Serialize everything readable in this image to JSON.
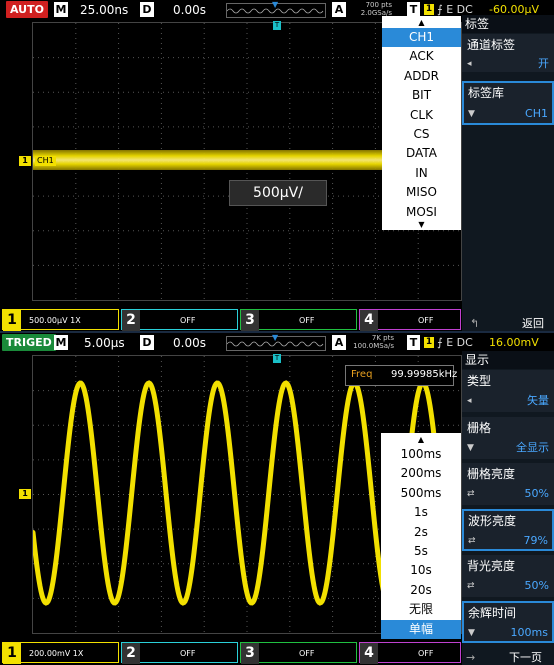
{
  "top": {
    "status": "AUTO",
    "m_label": "M",
    "timebase": "25.00ns",
    "d_label": "D",
    "delay": "0.00s",
    "pts_line1": "700 pts",
    "pts_line2": "2.0GSa/s",
    "trig_t": "T",
    "trig_ch": "1",
    "trig_edge": "⨍ E DC",
    "trig_level": "-60.00μV",
    "a_label": "A",
    "ch1_marker": "1",
    "ch1_tag": "CH1",
    "scale_box": "500μV/",
    "t_marker": "T",
    "menu": {
      "title": "标签",
      "item1_label": "通道标签",
      "item1_value": "开",
      "item2_label": "标签库",
      "item2_value": "CH1",
      "back": "返回"
    },
    "dropdown": [
      "CH1",
      "ACK",
      "ADDR",
      "BIT",
      "CLK",
      "CS",
      "DATA",
      "IN",
      "MISO",
      "MOSI"
    ],
    "dropdown_selected": "CH1",
    "channels": [
      {
        "num": "1",
        "text": "500.00μV  1X"
      },
      {
        "num": "2",
        "text": "OFF"
      },
      {
        "num": "3",
        "text": "OFF"
      },
      {
        "num": "4",
        "text": "OFF"
      }
    ],
    "colors": {
      "ch1": "#f2e000",
      "ch2": "#2ad0d8",
      "ch3": "#20c040",
      "ch4": "#c040d0",
      "accent": "#2a8ad8"
    }
  },
  "bottom": {
    "status": "TRIGED",
    "m_label": "M",
    "timebase": "5.00μs",
    "d_label": "D",
    "delay": "0.00s",
    "pts_line1": "7K pts",
    "pts_line2": "100.0MSa/s",
    "a_label": "A",
    "trig_t": "T",
    "trig_ch": "1",
    "trig_edge": "⨍ E DC",
    "trig_level": "16.00mV",
    "ch1_marker": "1",
    "t_marker": "T",
    "freq_label": "Freq",
    "freq_value": "99.99985kHz",
    "menu": {
      "title": "显示",
      "items": [
        {
          "label": "类型",
          "value": "矢量"
        },
        {
          "label": "栅格",
          "value": "全显示"
        },
        {
          "label": "栅格亮度",
          "value": "50%"
        },
        {
          "label": "波形亮度",
          "value": "79%"
        },
        {
          "label": "背光亮度",
          "value": "50%"
        },
        {
          "label": "余辉时间",
          "value": "100ms"
        }
      ],
      "next": "下一页"
    },
    "dropdown": [
      "100ms",
      "200ms",
      "500ms",
      "1s",
      "2s",
      "5s",
      "10s",
      "20s",
      "无限",
      "单幅"
    ],
    "dropdown_selected": "单幅",
    "channels": [
      {
        "num": "1",
        "text": "200.00mV  1X"
      },
      {
        "num": "2",
        "text": "OFF"
      },
      {
        "num": "3",
        "text": "OFF"
      },
      {
        "num": "4",
        "text": "OFF"
      }
    ]
  }
}
